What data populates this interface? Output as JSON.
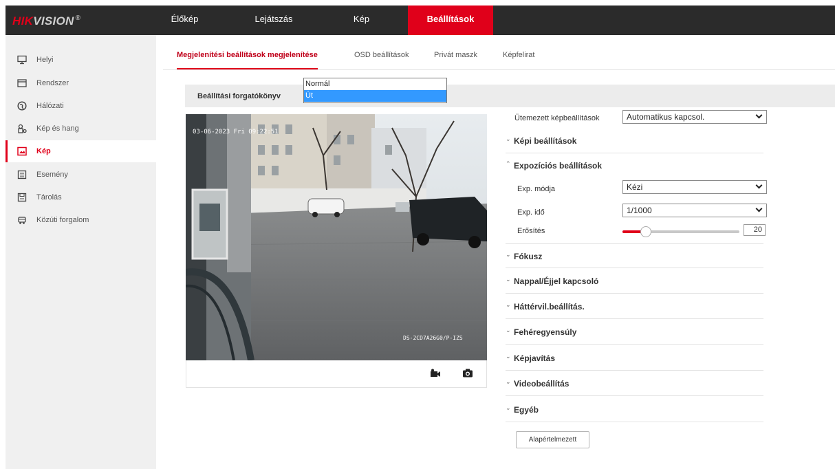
{
  "brand": {
    "hik": "HIK",
    "vision": "VISION",
    "reg": "®",
    "accent": "#e0001a"
  },
  "nav": {
    "items": [
      "Élőkép",
      "Lejátszás",
      "Kép",
      "Beállítások"
    ],
    "active": "Beállítások"
  },
  "sidebar": {
    "items": [
      {
        "label": "Helyi",
        "icon": "monitor-icon"
      },
      {
        "label": "Rendszer",
        "icon": "system-icon"
      },
      {
        "label": "Hálózati",
        "icon": "globe-icon"
      },
      {
        "label": "Kép és hang",
        "icon": "video-audio-icon"
      },
      {
        "label": "Kép",
        "icon": "image-icon",
        "active": true
      },
      {
        "label": "Esemény",
        "icon": "event-icon"
      },
      {
        "label": "Tárolás",
        "icon": "storage-icon"
      },
      {
        "label": "Közúti forgalom",
        "icon": "traffic-icon"
      }
    ]
  },
  "tabs": [
    {
      "label": "Megjelenítési beállítások megjelenítése",
      "active": true
    },
    {
      "label": "OSD beállítások"
    },
    {
      "label": "Privát maszk"
    },
    {
      "label": "Képfelirat"
    }
  ],
  "scenario": {
    "label": "Beállítási forgatókönyv",
    "options": [
      "Normál",
      "Út"
    ],
    "highlighted": "Út"
  },
  "video": {
    "timestamp": "03-06-2023 Fri 09:22:51",
    "camera_name": "DS-2CD7A26G0/P-IZS"
  },
  "video_toolbar": {
    "record_icon": "record-icon",
    "snapshot_icon": "camera-icon"
  },
  "schedule": {
    "label": "Ütemezett képbeállítások",
    "value": "Automatikus kapcsol."
  },
  "sections": {
    "image_settings": "Képi beállítások",
    "exposure": "Expozíciós beállítások",
    "focus": "Fókusz",
    "day_night": "Nappal/Éjjel kapcsoló",
    "backlight": "Háttérvil.beállítás.",
    "white_balance": "Fehéregyensúly",
    "enhancement": "Képjavítás",
    "video_adjust": "Videobeállítás",
    "other": "Egyéb"
  },
  "exposure": {
    "mode_label": "Exp. módja",
    "mode_value": "Kézi",
    "time_label": "Exp. idő",
    "time_value": "1/1000",
    "gain_label": "Erősítés",
    "gain_value": "20",
    "gain_max": 100
  },
  "buttons": {
    "default": "Alapértelmezett"
  }
}
